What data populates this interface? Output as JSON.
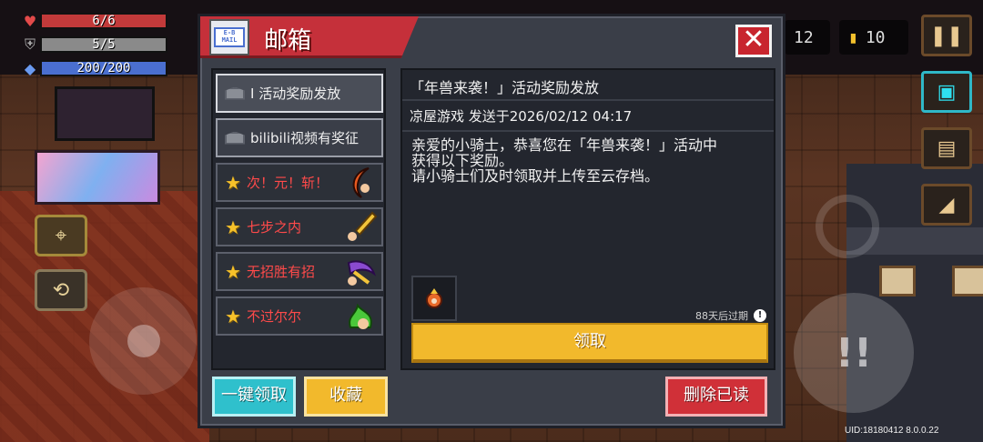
{
  "hud": {
    "hp": "6/6",
    "armor": "5/5",
    "energy": "200/200"
  },
  "top_right": {
    "gems": "12",
    "coins": "10"
  },
  "dialog": {
    "title": "邮箱",
    "title_icon_text": "E-B MAIL"
  },
  "mail_list": [
    {
      "label": "I 活动奖励发放",
      "type": "read",
      "highlight": false
    },
    {
      "label": "bilibili视频有奖征",
      "type": "read",
      "highlight": false
    },
    {
      "label": "次！元！斩！",
      "type": "starred",
      "highlight": true
    },
    {
      "label": "七步之内",
      "type": "starred",
      "highlight": true
    },
    {
      "label": "无招胜有招",
      "type": "starred",
      "highlight": true
    },
    {
      "label": "不过尔尔",
      "type": "starred",
      "highlight": true
    }
  ],
  "detail": {
    "subject": "「年兽来袭！」活动奖励发放",
    "sender_line": "凉屋游戏 发送于2026/02/12 04:17",
    "body": "亲爱的小骑士，恭喜您在「年兽来袭！」活动中\n获得以下奖励。\n请小骑士们及时领取并上传至云存档。",
    "expire": "88天后过期",
    "claim": "领取"
  },
  "buttons": {
    "claim_all": "一键领取",
    "favorite": "收藏",
    "delete_read": "删除已读"
  },
  "uid": "UID:18180412 8.0.0.22"
}
